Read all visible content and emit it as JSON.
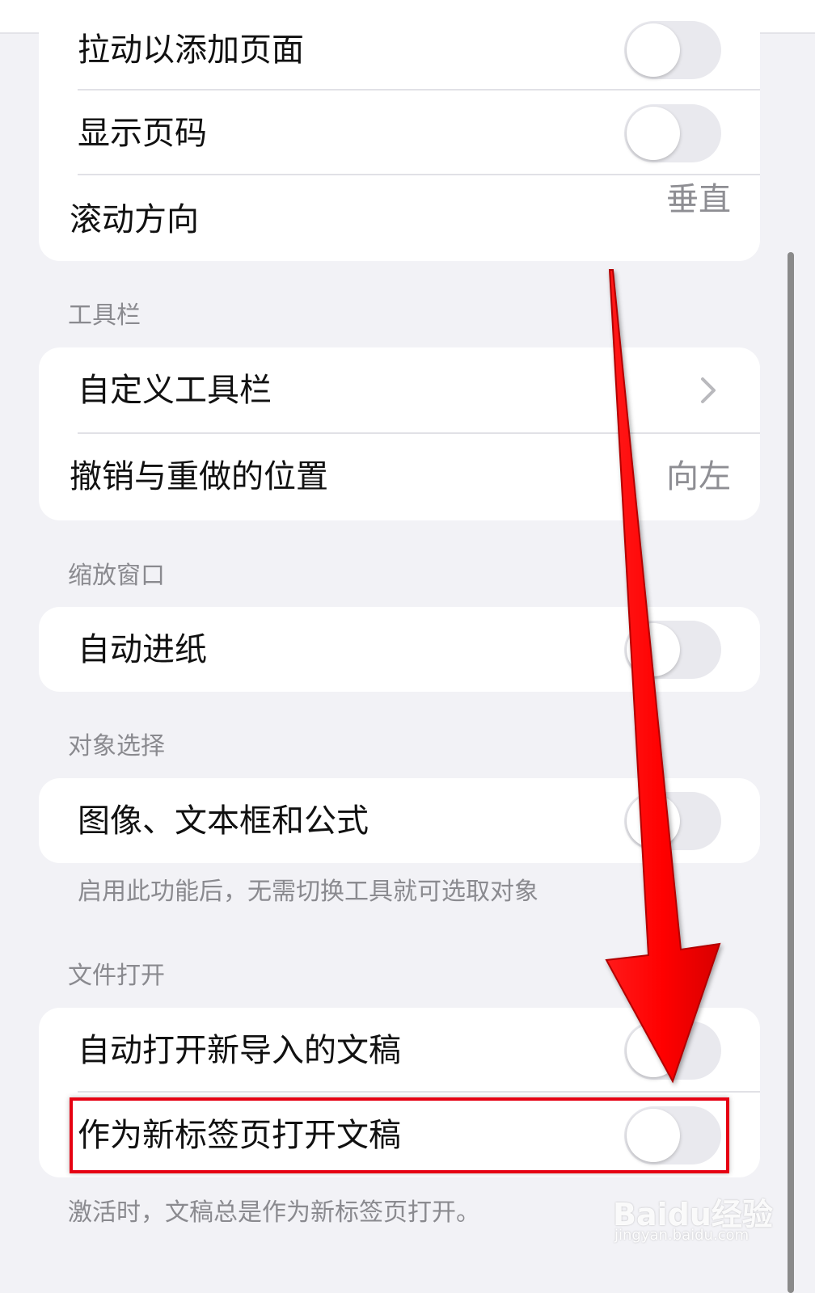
{
  "scroll_section": {
    "rows": [
      {
        "label": "拉动以添加页面",
        "toggle": false
      },
      {
        "label": "显示页码",
        "toggle": false
      },
      {
        "label": "滚动方向",
        "value": "垂直"
      }
    ]
  },
  "toolbar_section": {
    "header": "工具栏",
    "rows": [
      {
        "label": "自定义工具栏"
      },
      {
        "label": "撤销与重做的位置",
        "value": "向左"
      }
    ]
  },
  "zoom_section": {
    "header": "缩放窗口",
    "rows": [
      {
        "label": "自动进纸",
        "toggle": false
      }
    ]
  },
  "object_section": {
    "header": "对象选择",
    "rows": [
      {
        "label": "图像、文本框和公式",
        "toggle": false
      }
    ],
    "footnote": "启用此功能后，无需切换工具就可选取对象"
  },
  "file_section": {
    "header": "文件打开",
    "rows": [
      {
        "label": "自动打开新导入的文稿",
        "toggle": false
      },
      {
        "label": "作为新标签页打开文稿",
        "toggle": false
      }
    ],
    "footnote": "激活时，文稿总是作为新标签页打开。"
  },
  "watermark": {
    "brand": "Baidu经验",
    "url": "jingyan.baidu.com"
  },
  "annotation_color": "#e60012"
}
